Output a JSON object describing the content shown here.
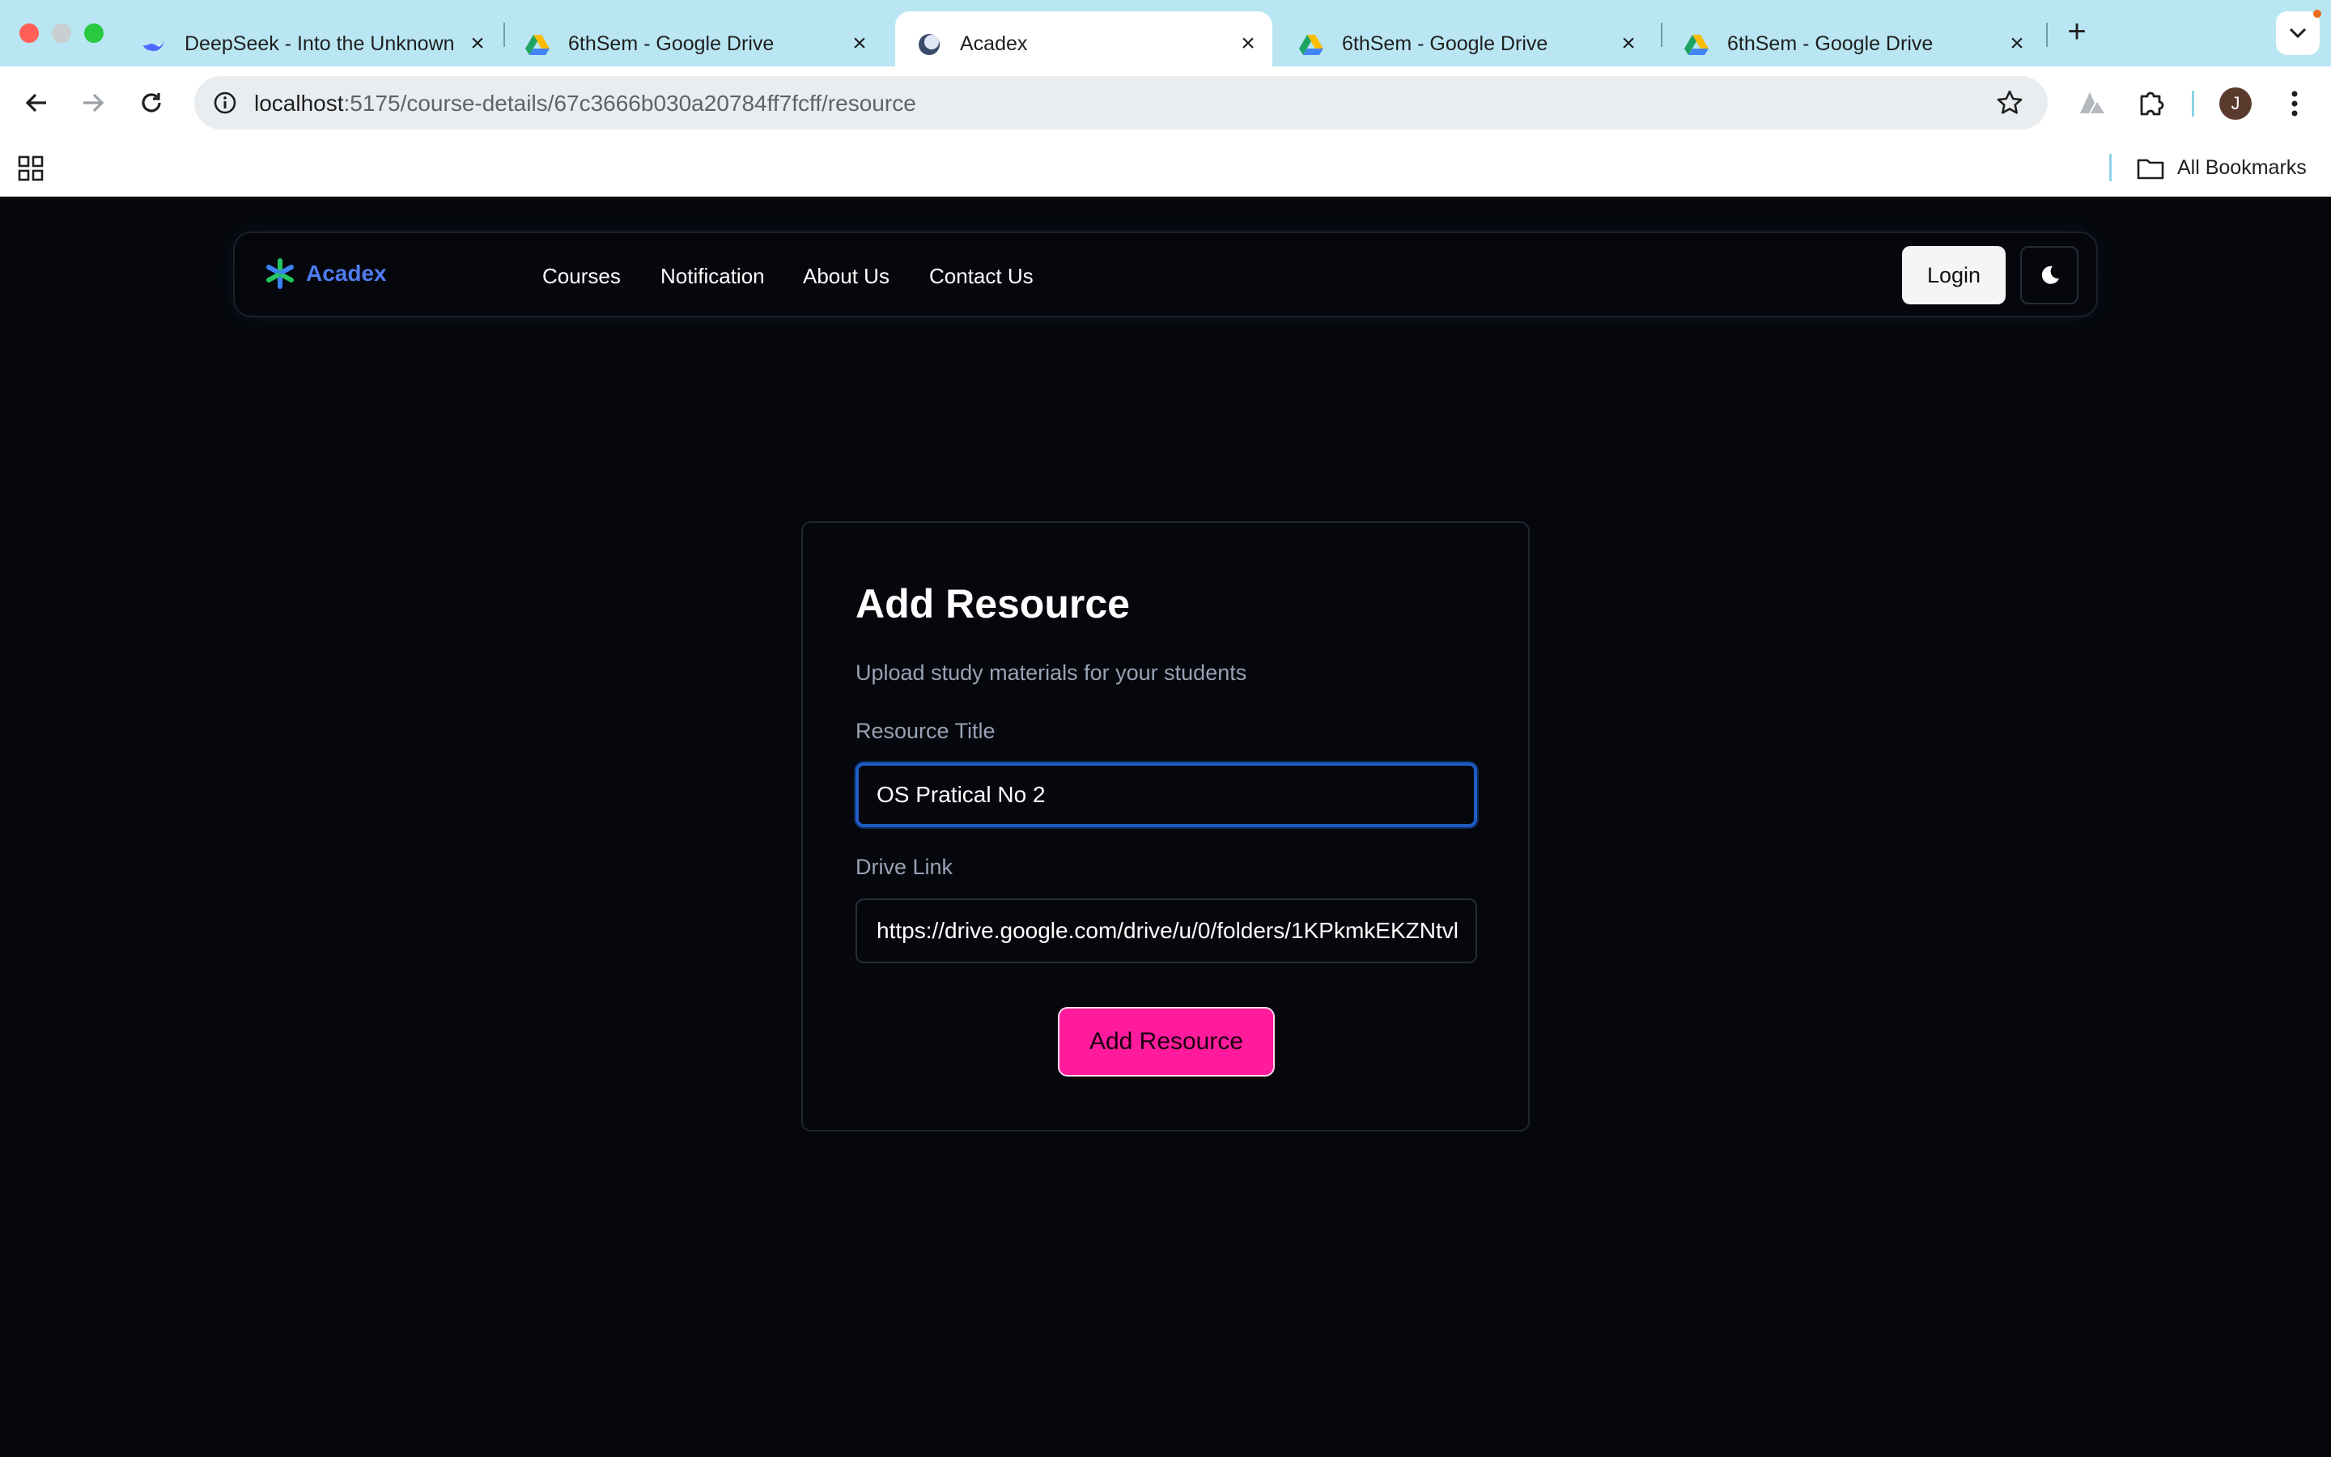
{
  "browser": {
    "tabs": [
      {
        "title": "DeepSeek - Into the Unknown",
        "active": false,
        "favicon": "deepseek-whale-icon"
      },
      {
        "title": "6thSem - Google Drive",
        "active": false,
        "favicon": "google-drive-icon"
      },
      {
        "title": "Acadex",
        "active": true,
        "favicon": "acadex-icon"
      },
      {
        "title": "6thSem - Google Drive",
        "active": false,
        "favicon": "google-drive-icon"
      },
      {
        "title": "6thSem - Google Drive",
        "active": false,
        "favicon": "google-drive-icon"
      }
    ],
    "url_host": "localhost",
    "url_rest": ":5175/course-details/67c3666b030a20784ff7fcff/resource",
    "profile_initial": "J",
    "bookmarks_label": "All Bookmarks"
  },
  "navbar": {
    "brand": "Acadex",
    "links": [
      "Courses",
      "Notification",
      "About Us",
      "Contact Us"
    ],
    "login_label": "Login",
    "theme_icon": "moon-icon"
  },
  "form": {
    "title": "Add Resource",
    "subtitle": "Upload study materials for your students",
    "title_label": "Resource Title",
    "title_value": "OS Pratical No 2",
    "link_label": "Drive Link",
    "link_value": "https://drive.google.com/drive/u/0/folders/1KPkmkEKZNtvl",
    "submit_label": "Add Resource"
  },
  "colors": {
    "tabstrip": "#b9e6f2",
    "page_bg": "#05070c",
    "brand": "#4f7cf0",
    "accent_button": "#ff1b9c",
    "focus_ring": "#1f5cc4"
  }
}
